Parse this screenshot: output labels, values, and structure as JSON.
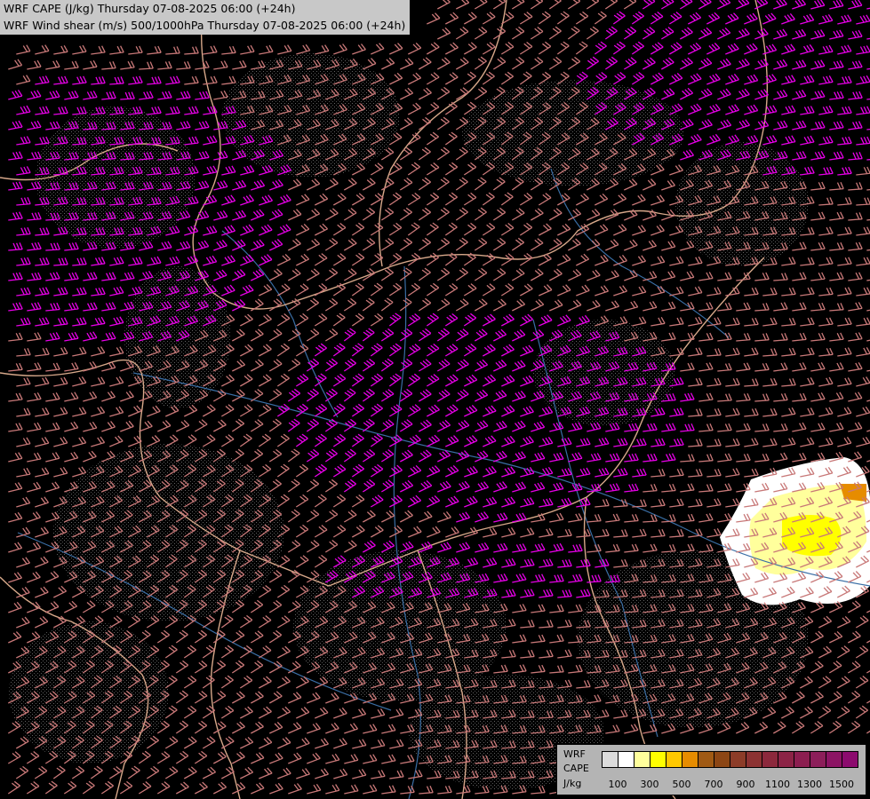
{
  "title": {
    "line1": "WRF CAPE (J/kg) Thursday 07-08-2025 06:00 (+24h)",
    "line2": "WRF Wind shear (m/s) 500/1000hPa Thursday 07-08-2025 06:00 (+24h)"
  },
  "legend": {
    "model": "WRF",
    "field": "CAPE",
    "unit": "J/kg",
    "colors": [
      "#dcdcdc",
      "#ffffff",
      "#ffff9c",
      "#ffff00",
      "#ffc800",
      "#e68c00",
      "#a05a14",
      "#8c4614",
      "#8c3c28",
      "#8c3232",
      "#8c283c",
      "#8c2346",
      "#8c1e50",
      "#8c1e5a",
      "#8c1464",
      "#8c0a6e"
    ],
    "tick_labels": [
      "100",
      "300",
      "500",
      "700",
      "900",
      "1100",
      "1300",
      "1500"
    ]
  },
  "map": {
    "background_color": "#000000",
    "border_color": "#d7a88a",
    "river_color": "#3a6ea5",
    "contour_color": "#a0a0a0",
    "barb_color_low": "#c87878",
    "barb_color_high": "#e600e6",
    "cape_core_color": "#ffff00",
    "cape_edge_color": "#ffffff"
  }
}
